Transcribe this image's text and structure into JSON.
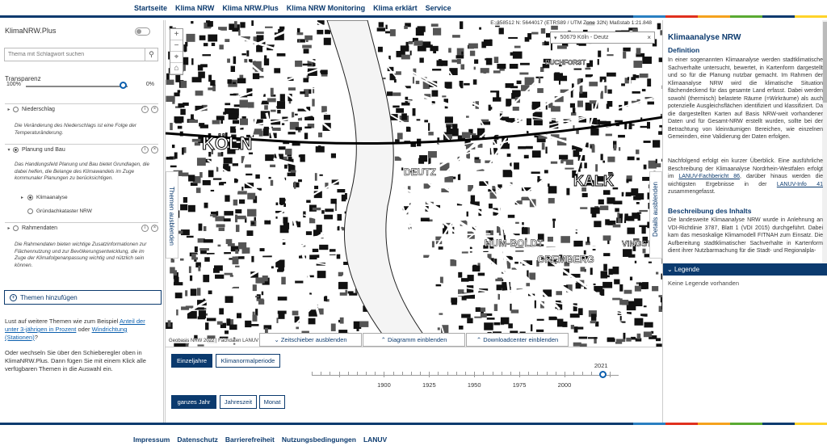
{
  "topnav": [
    "Startseite",
    "Klima NRW",
    "Klima NRW.Plus",
    "Klima NRW Monitoring",
    "Klima erklärt",
    "Service"
  ],
  "stripe_colors": [
    "#2a7fc1",
    "#e0301e",
    "#f5a21e",
    "#5aaa32",
    "#0b3a6e",
    "#ffd32a"
  ],
  "left": {
    "title": "KlimaNRW.Plus",
    "search_placeholder": "Thema mit Schlagwort suchen",
    "transparency_label": "Transparenz",
    "transparency_left": "100%",
    "transparency_right": "0%",
    "transparency_value": 0.0,
    "tree": [
      {
        "label": "Niederschlag",
        "desc": "Die Veränderung des Niederschlags ist eine Folge der Temperaturänderung."
      },
      {
        "label": "Planung und Bau",
        "desc": "Das Handlungsfeld Planung und Bau bietet Grundlagen, die dabei helfen, die Belange des Klimawandels im Zuge kommunaler Planungen zu berücksichtigen."
      },
      {
        "label": "Rahmendaten",
        "desc": "Die Rahmendaten bieten wichtige Zusatzinformationen zur Flächennutzung und zur Bevölkerungsentwicklung, die im Zuge der Klimafolgenanpassung wichtig und nützlich sein können."
      }
    ],
    "sub": [
      "Klimaanalyse",
      "Gründachkataster NRW"
    ],
    "add_button": "Themen hinzufügen",
    "info1_a": "Lust auf weitere Themen wie zum Beispiel",
    "info1_link1": "Anteil der unter 3-jährigen in Prozent",
    "info1_b": "oder",
    "info1_link2": "Windrichtung (Stationen)",
    "info1_c": "?",
    "info2": "Oder wechseln Sie über den Schieberegler oben in KlimaNRW.Plus. Dann fügen Sie mit einem Klick alle verfügbaren Themen in die Auswahl ein."
  },
  "map": {
    "coords": "E: 358512 N: 5644017 (ETRS89 / UTM Zone 32N) Maßstab 1:21.848",
    "location": "50679 Köln - Deutz",
    "left_tab": "Themen ausblenden",
    "right_tab": "Details ausblenden",
    "attribution": "Geobasis NRW 2022 | Fachdaten LANUV",
    "labels": [
      "KÖLN",
      "DEUTZ",
      "KALK",
      "HUM-BOLDT",
      "GREMBERG",
      "BUCHFORST",
      "VINGST"
    ],
    "bottom_buttons": [
      "Zeitschieber ausblenden",
      "Diagramm einblenden",
      "Downloadcenter einblenden"
    ]
  },
  "time": {
    "btn_einzeljahre": "Einzeljahre",
    "btn_klimanormal": "Klimanormalperiode",
    "btn_ganzes": "ganzes Jahr",
    "btn_jahreszeit": "Jahreszeit",
    "btn_monat": "Monat",
    "ticks": [
      "1900",
      "1925",
      "1950",
      "1975",
      "2000"
    ],
    "current_year": "2021"
  },
  "right": {
    "title": "Klimaanalyse NRW",
    "h_def": "Definition",
    "def_text": "In einer sogenannten Klimaanalyse werden stadtklimatische Sachverhalte untersucht, bewertet, in Kartenform dargestellt und so für die Planung nutzbar gemacht. Im Rahmen der Klimaanalyse NRW wird die klimatische Situation flächendeckend für das gesamte Land erfasst. Dabei werden sowohl (thermisch) belastete Räume (=Wirkräume) als auch potenzielle Ausgleichsflächen identifiziert und klassifiziert. Da die dargestellten Karten auf Basis NRW-weit vorhandener Daten und für Gesamt-NRW erstellt wurden, sollte bei der Betrachtung von kleinräumigen Bereichen, wie einzelnen Gemeinden, eine Validierung der Daten erfolgen.",
    "def_text2a": "Nachfolgend erfolgt ein kurzer Überblick. Eine ausführliche Beschreibung der Klimaanalyse Nordrhein-Westfalen erfolgt im",
    "def_link1": "LANUV-Fachbericht 86",
    "def_text2b": ", darüber hinaus werden die wichtigsten Ergebnisse in der",
    "def_link2": "LANUV-Info 41",
    "def_text2c": "zusammengefasst.",
    "h_inhalt": "Beschreibung des Inhalts",
    "inhalt_text": "Die landesweite Klimaanalyse NRW wurde in Anlehnung an VDI-Richtlinie 3787, Blatt 1 (VDI 2015) durchgeführt. Dabei kam das mesoskalige Klimamodell FITNAH zum Einsatz. Die Aufbereitung stadtklimatischer Sachverhalte in Kartenform dient ihrer Nutzbarmachung für die Stadt- und Regionalpla-",
    "legend": "Legende",
    "legend_empty": "Keine Legende vorhanden"
  },
  "footer": [
    "Impressum",
    "Datenschutz",
    "Barrierefreiheit",
    "Nutzungsbedingungen",
    "LANUV"
  ]
}
